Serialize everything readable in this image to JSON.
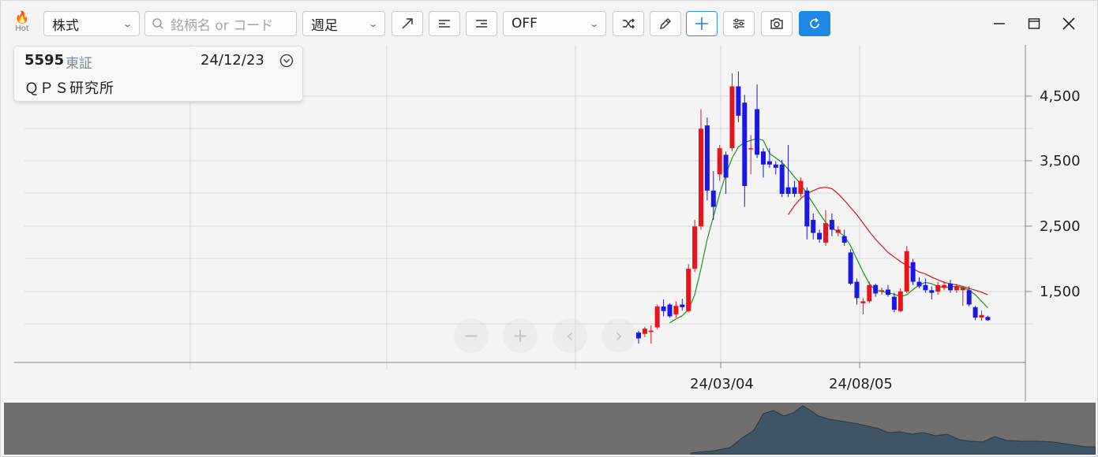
{
  "toolbar": {
    "hot_label": "Hot",
    "market_type": "株式",
    "search_placeholder": "銘柄名 or コード",
    "period": "週足",
    "indicator": "OFF"
  },
  "info": {
    "code": "5595",
    "market": "東証",
    "date": "24/12/23",
    "name": "ＱＰＳ研究所"
  },
  "chart_data": {
    "type": "candlestick",
    "yticks": [
      "4,500",
      "3,500",
      "2,500",
      "1,500"
    ],
    "xticks": [
      "24/03/04",
      "24/08/05"
    ],
    "ylim": [
      400,
      5000
    ],
    "candles": [
      {
        "o": 870,
        "h": 900,
        "l": 700,
        "c": 780,
        "up": false
      },
      {
        "o": 850,
        "h": 960,
        "l": 800,
        "c": 930,
        "up": true
      },
      {
        "o": 900,
        "h": 980,
        "l": 700,
        "c": 880,
        "up": true
      },
      {
        "o": 950,
        "h": 1300,
        "l": 920,
        "c": 1270,
        "up": true
      },
      {
        "o": 1270,
        "h": 1380,
        "l": 1120,
        "c": 1200,
        "up": false
      },
      {
        "o": 1300,
        "h": 1320,
        "l": 1100,
        "c": 1120,
        "up": false
      },
      {
        "o": 1150,
        "h": 1350,
        "l": 1100,
        "c": 1280,
        "up": true
      },
      {
        "o": 1300,
        "h": 1390,
        "l": 1210,
        "c": 1260,
        "up": false
      },
      {
        "o": 1200,
        "h": 1920,
        "l": 1180,
        "c": 1850,
        "up": true
      },
      {
        "o": 1850,
        "h": 2600,
        "l": 1800,
        "c": 2500,
        "up": true
      },
      {
        "o": 2500,
        "h": 4300,
        "l": 2450,
        "c": 4000,
        "up": true
      },
      {
        "o": 4050,
        "h": 4170,
        "l": 2900,
        "c": 3050,
        "up": false
      },
      {
        "o": 3050,
        "h": 3350,
        "l": 2600,
        "c": 2800,
        "up": false
      },
      {
        "o": 3300,
        "h": 3750,
        "l": 3200,
        "c": 3700,
        "up": true
      },
      {
        "o": 3600,
        "h": 3650,
        "l": 3000,
        "c": 3250,
        "up": false
      },
      {
        "o": 3700,
        "h": 4850,
        "l": 3650,
        "c": 4650,
        "up": true
      },
      {
        "o": 4650,
        "h": 4880,
        "l": 4100,
        "c": 4200,
        "up": false
      },
      {
        "o": 4400,
        "h": 4520,
        "l": 2800,
        "c": 3120,
        "up": false
      },
      {
        "o": 3700,
        "h": 3900,
        "l": 3300,
        "c": 3700,
        "up": true
      },
      {
        "o": 4300,
        "h": 4680,
        "l": 3550,
        "c": 3600,
        "up": false
      },
      {
        "o": 3650,
        "h": 3700,
        "l": 3250,
        "c": 3450,
        "up": false
      },
      {
        "o": 3500,
        "h": 3700,
        "l": 3400,
        "c": 3450,
        "up": false
      },
      {
        "o": 3450,
        "h": 3500,
        "l": 3300,
        "c": 3400,
        "up": false
      },
      {
        "o": 3450,
        "h": 3520,
        "l": 2950,
        "c": 3000,
        "up": false
      },
      {
        "o": 3000,
        "h": 3750,
        "l": 2950,
        "c": 3100,
        "up": false
      },
      {
        "o": 3000,
        "h": 3200,
        "l": 2950,
        "c": 3100,
        "up": false
      },
      {
        "o": 3200,
        "h": 3250,
        "l": 2950,
        "c": 3000,
        "up": true
      },
      {
        "o": 3050,
        "h": 3100,
        "l": 2300,
        "c": 2500,
        "up": false
      },
      {
        "o": 2600,
        "h": 2700,
        "l": 2300,
        "c": 2400,
        "up": false
      },
      {
        "o": 2400,
        "h": 2450,
        "l": 2250,
        "c": 2300,
        "up": false
      },
      {
        "o": 2250,
        "h": 2750,
        "l": 2200,
        "c": 2550,
        "up": true
      },
      {
        "o": 2600,
        "h": 2700,
        "l": 2350,
        "c": 2450,
        "up": false
      },
      {
        "o": 2450,
        "h": 2500,
        "l": 2350,
        "c": 2400,
        "up": true
      },
      {
        "o": 2350,
        "h": 2450,
        "l": 2200,
        "c": 2250,
        "up": false
      },
      {
        "o": 2100,
        "h": 2150,
        "l": 1600,
        "c": 1620,
        "up": false
      },
      {
        "o": 1650,
        "h": 1700,
        "l": 1300,
        "c": 1400,
        "up": false
      },
      {
        "o": 1350,
        "h": 1400,
        "l": 1150,
        "c": 1320,
        "up": true
      },
      {
        "o": 1350,
        "h": 1650,
        "l": 1320,
        "c": 1600,
        "up": true
      },
      {
        "o": 1600,
        "h": 1620,
        "l": 1420,
        "c": 1470,
        "up": false
      },
      {
        "o": 1500,
        "h": 1560,
        "l": 1450,
        "c": 1520,
        "up": true
      },
      {
        "o": 1530,
        "h": 1600,
        "l": 1420,
        "c": 1450,
        "up": false
      },
      {
        "o": 1420,
        "h": 1480,
        "l": 1180,
        "c": 1220,
        "up": false
      },
      {
        "o": 1200,
        "h": 1550,
        "l": 1180,
        "c": 1500,
        "up": true
      },
      {
        "o": 1500,
        "h": 2200,
        "l": 1480,
        "c": 2120,
        "up": true
      },
      {
        "o": 1950,
        "h": 2000,
        "l": 1600,
        "c": 1650,
        "up": false
      },
      {
        "o": 1650,
        "h": 1720,
        "l": 1550,
        "c": 1580,
        "up": false
      },
      {
        "o": 1600,
        "h": 1700,
        "l": 1480,
        "c": 1520,
        "up": false
      },
      {
        "o": 1520,
        "h": 1580,
        "l": 1380,
        "c": 1480,
        "up": false
      },
      {
        "o": 1500,
        "h": 1650,
        "l": 1450,
        "c": 1600,
        "up": true
      },
      {
        "o": 1600,
        "h": 1660,
        "l": 1520,
        "c": 1560,
        "up": true
      },
      {
        "o": 1620,
        "h": 1680,
        "l": 1480,
        "c": 1520,
        "up": false
      },
      {
        "o": 1520,
        "h": 1620,
        "l": 1480,
        "c": 1580,
        "up": true
      },
      {
        "o": 1560,
        "h": 1580,
        "l": 1280,
        "c": 1520,
        "up": true
      },
      {
        "o": 1520,
        "h": 1580,
        "l": 1270,
        "c": 1300,
        "up": false
      },
      {
        "o": 1260,
        "h": 1280,
        "l": 1060,
        "c": 1100,
        "up": false
      },
      {
        "o": 1140,
        "h": 1210,
        "l": 1050,
        "c": 1100,
        "up": true
      },
      {
        "o": 1110,
        "h": 1130,
        "l": 1050,
        "c": 1060,
        "up": false
      }
    ],
    "ma_short": [
      null,
      null,
      null,
      null,
      null,
      1020,
      1080,
      1130,
      1220,
      1450,
      1850,
      2300,
      2650,
      3000,
      3300,
      3550,
      3720,
      3790,
      3820,
      3850,
      3820,
      3620,
      3550,
      3480,
      3380,
      3260,
      3150,
      3000,
      2850,
      2700,
      2560,
      2470,
      2420,
      2350,
      2200,
      2000,
      1800,
      1620,
      1520,
      1500,
      1480,
      1460,
      1420,
      1450,
      1530,
      1600,
      1640,
      1620,
      1580,
      1560,
      1570,
      1580,
      1560,
      1520,
      1450,
      1350,
      1250
    ],
    "ma_long": [
      null,
      null,
      null,
      null,
      null,
      null,
      null,
      null,
      null,
      null,
      null,
      null,
      null,
      null,
      null,
      null,
      null,
      null,
      null,
      null,
      null,
      null,
      null,
      null,
      2680,
      2820,
      2930,
      3000,
      3050,
      3090,
      3100,
      3080,
      3000,
      2900,
      2790,
      2680,
      2550,
      2420,
      2300,
      2200,
      2100,
      2030,
      1960,
      1900,
      1850,
      1800,
      1770,
      1720,
      1680,
      1640,
      1620,
      1600,
      1580,
      1550,
      1520,
      1490,
      1450
    ]
  }
}
